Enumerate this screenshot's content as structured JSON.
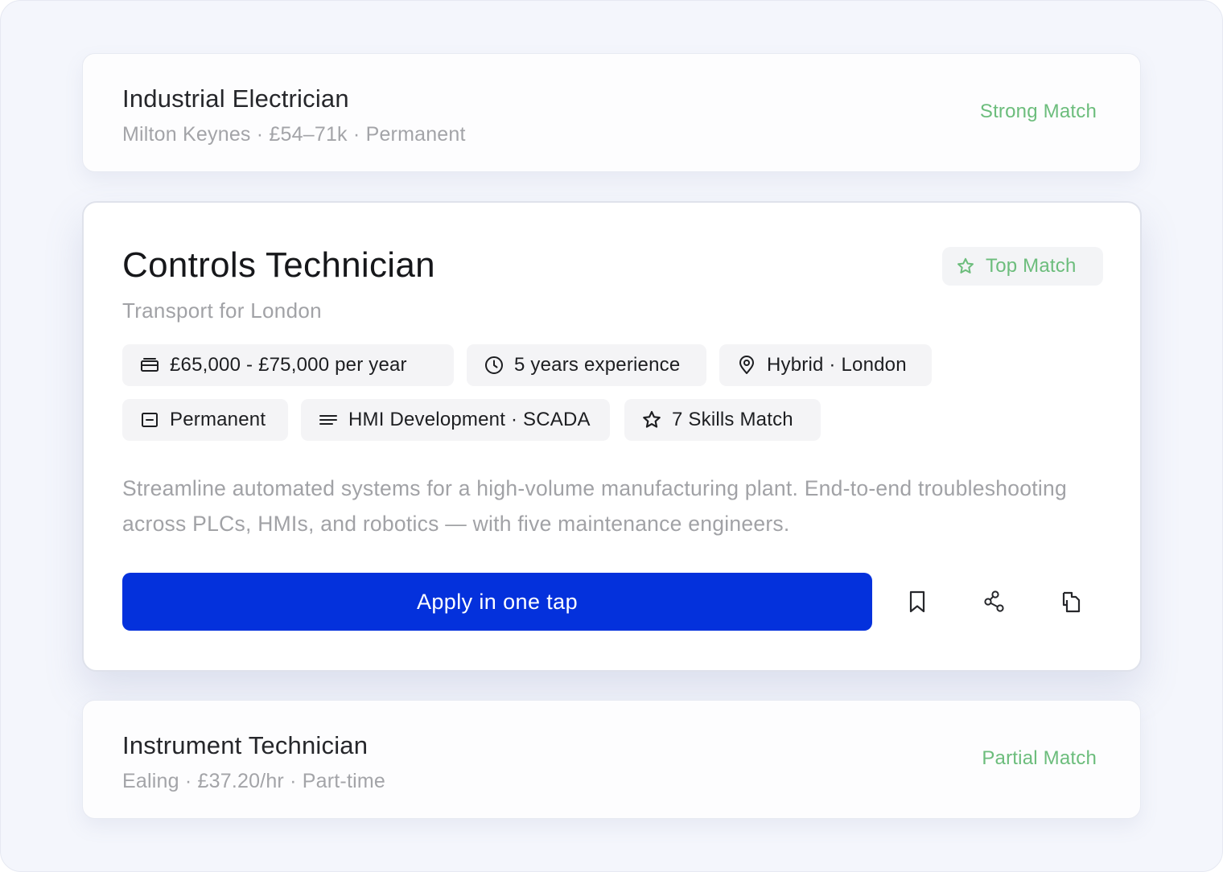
{
  "jobs": {
    "top": {
      "title": "Industrial Electrician",
      "meta": "Milton Keynes · £54–71k · Permanent",
      "match": "Strong Match"
    },
    "featured": {
      "title": "Controls Technician",
      "company": "Transport for London",
      "badge": {
        "label": "Top Match",
        "icon": "star-icon"
      },
      "chips": [
        {
          "label": "£65,000 - £75,000 per year",
          "icon": "wallet-icon"
        },
        {
          "label": "5 years experience",
          "icon": "clock-icon"
        },
        {
          "label": "Hybrid · London",
          "icon": "location-pin-icon"
        },
        {
          "label": "Permanent",
          "icon": "calendar-icon"
        },
        {
          "label": "HMI Development · SCADA",
          "icon": "lines-icon"
        },
        {
          "label": "7 Skills Match",
          "icon": "star-icon"
        }
      ],
      "description": "Streamline automated systems for a high-volume manufacturing plant. End-to-end troubleshooting across PLCs, HMIs, and robotics — with five maintenance engineers.",
      "actions": {
        "apply_label": "Apply in one tap",
        "icons": [
          "bookmark-icon",
          "share-icon",
          "copy-icon"
        ]
      }
    },
    "bottom": {
      "title": "Instrument Technician",
      "meta": "Ealing · £37.20/hr · Part-time",
      "match": "Partial Match"
    }
  },
  "colors": {
    "accent": "#0431dc",
    "match_green": "#6cbd7c",
    "background": "#f4f6fc"
  }
}
